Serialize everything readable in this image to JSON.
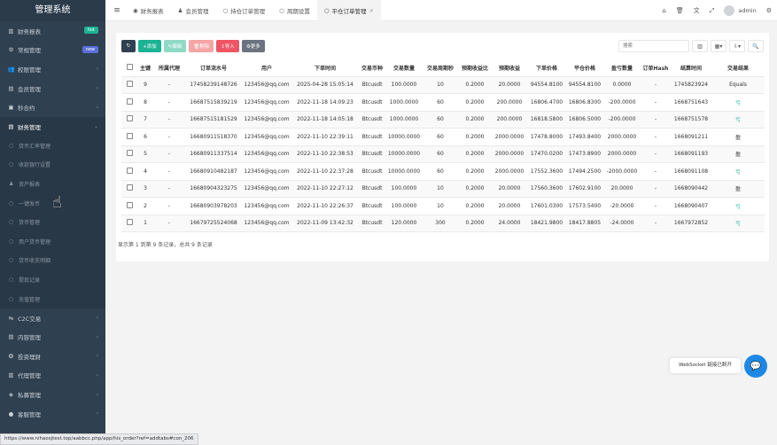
{
  "sidebar": {
    "brand": "管理系统",
    "items": [
      {
        "icon": "▥",
        "label": "财务报表",
        "badge": "hot",
        "badge_type": "hot"
      },
      {
        "icon": "⚙",
        "label": "常规管理",
        "badge": "new",
        "badge_type": "new"
      },
      {
        "icon": "👥",
        "label": "权限管理",
        "arrow": "‹"
      },
      {
        "icon": "▤",
        "label": "会员管理",
        "arrow": "‹"
      },
      {
        "icon": "▣",
        "label": "秒合约",
        "arrow": "‹"
      },
      {
        "icon": "▤",
        "label": "财务管理",
        "arrow": "⌄"
      }
    ],
    "sub_items": [
      {
        "icon": "○",
        "label": "货币汇率管理"
      },
      {
        "icon": "○",
        "label": "收款银行设置"
      },
      {
        "icon": "♟",
        "label": "资产报表"
      },
      {
        "icon": "○",
        "label": "一键发币"
      },
      {
        "icon": "○",
        "label": "货币管理"
      },
      {
        "icon": "○",
        "label": "用户货币管理"
      },
      {
        "icon": "○",
        "label": "货币收支明细"
      },
      {
        "icon": "○",
        "label": "提现记录"
      },
      {
        "icon": "○",
        "label": "充值管理"
      }
    ],
    "bottom_items": [
      {
        "icon": "⇆",
        "label": "C2C交易",
        "arrow": "‹"
      },
      {
        "icon": "▤",
        "label": "内容管理",
        "arrow": "‹"
      },
      {
        "icon": "✪",
        "label": "投资理财",
        "arrow": "‹"
      },
      {
        "icon": "▥",
        "label": "代理管理",
        "arrow": "‹"
      },
      {
        "icon": "◈",
        "label": "私募管理",
        "arrow": "‹"
      },
      {
        "icon": "●",
        "label": "客服管理",
        "arrow": "‹"
      }
    ]
  },
  "topbar": {
    "toggle": "≡",
    "tabs": [
      {
        "icon": "◉",
        "label": "财务报表"
      },
      {
        "icon": "♟",
        "label": "会员管理"
      },
      {
        "icon": "○",
        "label": "持仓订单管理"
      },
      {
        "icon": "○",
        "label": "周期设置"
      },
      {
        "icon": "○",
        "label": "平仓订单管理",
        "close": "×",
        "active": true
      }
    ],
    "user": "admin"
  },
  "toolbar": {
    "refresh": "↻",
    "add": "+添加",
    "edit": "✎编辑",
    "delete": "🗑删除",
    "import": "⇪导入",
    "more": "⚙更多"
  },
  "search": {
    "placeholder": "搜索",
    "btn_columns": "▥",
    "btn_grid": "▦▾",
    "btn_export": "⇩▾",
    "btn_search": "🔍"
  },
  "table": {
    "headers": [
      "",
      "主键",
      "所属代理",
      "订单流水号",
      "用户",
      "下单时间",
      "交易币种",
      "交易数量",
      "交易周期秒",
      "预期收益比",
      "预期收益",
      "下单价格",
      "平仓价格",
      "盈亏数量",
      "订单Hash",
      "结算时间",
      "交易结果"
    ],
    "rows": [
      [
        "9",
        "-",
        "17458239148726",
        "123456@qq.com",
        "2025-04-28 15:05:14",
        "Btcusdt",
        "100.0000",
        "10",
        "0.2000",
        "20.0000",
        "94554.8100",
        "94554.8100",
        "0.0000",
        "-",
        "1745823924",
        "Equals"
      ],
      [
        "8",
        "-",
        "16687515839219",
        "123456@qq.com",
        "2022-11-18 14:09:23",
        "Btcusdt",
        "1000.0000",
        "60",
        "0.2000",
        "200.0000",
        "16806.4700",
        "16806.8300",
        "-200.0000",
        "-",
        "1668751643",
        "亏"
      ],
      [
        "7",
        "-",
        "16687515181529",
        "123456@qq.com",
        "2022-11-18 14:05:18",
        "Btcusdt",
        "1000.0000",
        "60",
        "0.2000",
        "200.0000",
        "16818.5800",
        "16806.5000",
        "-200.0000",
        "-",
        "1668751578",
        "亏"
      ],
      [
        "6",
        "-",
        "16680911518370",
        "123456@qq.com",
        "2022-11-10 22:39:11",
        "Btcusdt",
        "10000.0000",
        "60",
        "0.2000",
        "2000.0000",
        "17478.8000",
        "17493.8400",
        "2000.0000",
        "-",
        "1668091211",
        "盈"
      ],
      [
        "5",
        "-",
        "16680911337514",
        "123456@qq.com",
        "2022-11-10 22:38:53",
        "Btcusdt",
        "10000.0000",
        "60",
        "0.2000",
        "2000.0000",
        "17470.0200",
        "17473.8900",
        "2000.0000",
        "-",
        "1668091193",
        "盈"
      ],
      [
        "4",
        "-",
        "16680910482187",
        "123456@qq.com",
        "2022-11-10 22:37:28",
        "Btcusdt",
        "10000.0000",
        "60",
        "0.2000",
        "2000.0000",
        "17552.3600",
        "17494.2500",
        "-2000.0000",
        "-",
        "1668091108",
        "亏"
      ],
      [
        "3",
        "-",
        "16680904323275",
        "123456@qq.com",
        "2022-11-10 22:27:12",
        "Btcusdt",
        "100.0000",
        "10",
        "0.2000",
        "20.0000",
        "17560.3600",
        "17602.9100",
        "20.0000",
        "-",
        "1668090442",
        "盈"
      ],
      [
        "2",
        "-",
        "16680903978203",
        "123456@qq.com",
        "2022-11-10 22:26:37",
        "Btcusdt",
        "100.0000",
        "10",
        "0.2000",
        "20.0000",
        "17601.0300",
        "17573.5400",
        "-20.0000",
        "-",
        "1668090407",
        "亏"
      ],
      [
        "1",
        "-",
        "16679725524068",
        "123456@qq.com",
        "2022-11-09 13:42:32",
        "Btcusdt",
        "120.0000",
        "300",
        "0.2000",
        "24.0000",
        "18421.9800",
        "18417.8805",
        "-24.0000",
        "-",
        "1667972852",
        "亏"
      ]
    ]
  },
  "pager": "显示第 1 到第 9 条记录，总共 9 条记录",
  "websocket_tip": "WebSocket 链接已断开",
  "status_url": "https://www.nihaosjtest.top/aabbcc.php/app/his_order?ref=addtabs#con_206",
  "colors": {
    "sidebar_bg": "#2f4050",
    "accent_green": "#1ab394",
    "danger_red": "#ed5565",
    "chat_blue": "#1e88e5"
  }
}
